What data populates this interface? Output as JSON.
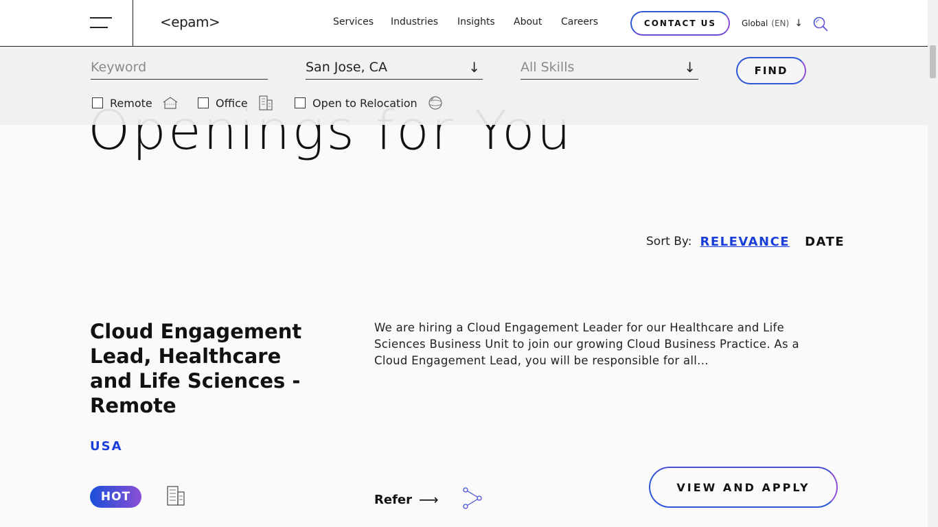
{
  "header": {
    "logo": "<epam>",
    "nav": [
      "Services",
      "Industries",
      "Insights",
      "About",
      "Careers"
    ],
    "contact_label": "CONTACT US",
    "global_label": "Global",
    "lang_label": "(EN)"
  },
  "hero": {
    "heading": "Openings for You"
  },
  "filters": {
    "keyword_placeholder": "Keyword",
    "location_value": "San Jose, CA",
    "skills_placeholder": "All Skills",
    "find_label": "FIND",
    "remote_label": "Remote",
    "office_label": "Office",
    "relocation_label": "Open to Relocation"
  },
  "sort": {
    "label": "Sort By:",
    "relevance": "RELEVANCE",
    "date": "DATE"
  },
  "job": {
    "title": "Cloud Engagement Lead, Healthcare and Life Sciences - Remote",
    "location": "USA",
    "description": "We are hiring a Cloud Engagement Leader for our Healthcare and Life Sciences Business Unit to join our growing Cloud Business Practice. As a Cloud Engagement Lead, you will be responsible for all...",
    "hot_label": "HOT",
    "refer_label": "Refer",
    "apply_label": "VIEW AND APPLY"
  },
  "colors": {
    "accent_blue": "#1a3fd8",
    "accent_purple": "#8a4fd6"
  },
  "icons": [
    "hamburger-icon",
    "search-icon",
    "chevron-down-icon",
    "home-icon",
    "office-building-icon",
    "relocation-icon",
    "arrow-right-icon",
    "share-icon"
  ]
}
